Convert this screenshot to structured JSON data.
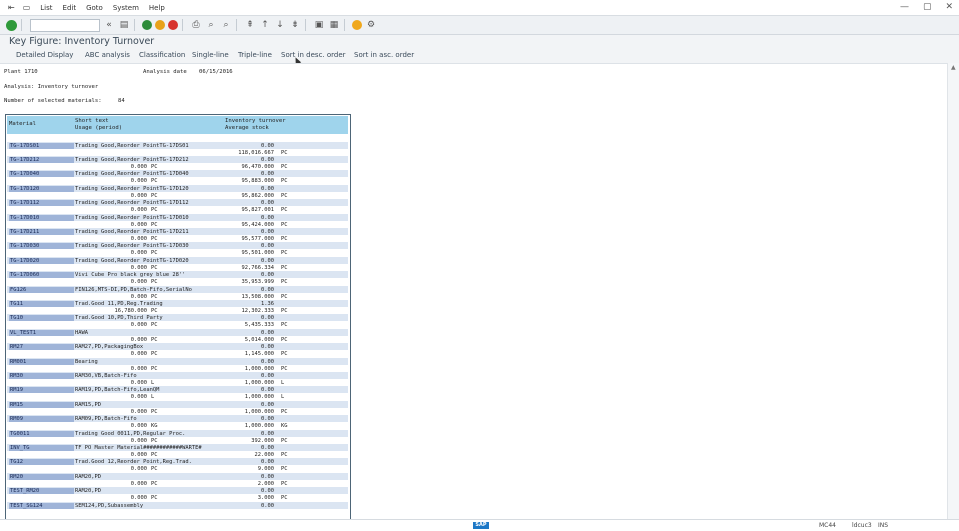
{
  "menu": {
    "items": [
      "List",
      "Edit",
      "Goto",
      "System",
      "Help"
    ]
  },
  "title": "Key Figure: Inventory Turnover",
  "app_toolbar": [
    "Detailed Display",
    "ABC analysis",
    "Classification",
    "Single-line",
    "Triple-line",
    "Sort in desc. order",
    "Sort in asc. order"
  ],
  "header": {
    "plant_label": "Plant 1710",
    "analysis_date_label": "Analysis date",
    "analysis_date": "06/15/2016",
    "analysis_label": "Analysis: Inventory turnover",
    "num_materials_label": "Number of selected materials:",
    "num_materials": "84"
  },
  "table": {
    "col1": "Material",
    "col2a": "Short text",
    "col2b": "Usage (period)",
    "col3a": "Inventory turnover",
    "col3b": "Average stock",
    "rows": [
      {
        "mat": "TG-17DS01",
        "text": "Trading Good,Reorder PointTG-17DS01",
        "v1": "0.00",
        "q": "",
        "u1": "",
        "v2": "118,016.667",
        "u2": "PC"
      },
      {
        "mat": "TG-17D212",
        "text": "Trading Good,Reorder PointTG-17D212",
        "v1": "0.00",
        "q": "0.000",
        "u1": "PC",
        "v2": "96,470.000",
        "u2": "PC"
      },
      {
        "mat": "TG-17D040",
        "text": "Trading Good,Reorder PointTG-17D040",
        "v1": "0.00",
        "q": "0.000",
        "u1": "PC",
        "v2": "95,883.000",
        "u2": "PC"
      },
      {
        "mat": "TG-17D120",
        "text": "Trading Good,Reorder PointTG-17D120",
        "v1": "0.00",
        "q": "0.000",
        "u1": "PC",
        "v2": "95,862.000",
        "u2": "PC"
      },
      {
        "mat": "TG-17D112",
        "text": "Trading Good,Reorder PointTG-17D112",
        "v1": "0.00",
        "q": "0.000",
        "u1": "PC",
        "v2": "95,827.001",
        "u2": "PC"
      },
      {
        "mat": "TG-17D010",
        "text": "Trading Good,Reorder PointTG-17D010",
        "v1": "0.00",
        "q": "0.000",
        "u1": "PC",
        "v2": "95,424.000",
        "u2": "PC"
      },
      {
        "mat": "TG-17D211",
        "text": "Trading Good,Reorder PointTG-17D211",
        "v1": "0.00",
        "q": "0.000",
        "u1": "PC",
        "v2": "95,577.000",
        "u2": "PC"
      },
      {
        "mat": "TG-17D030",
        "text": "Trading Good,Reorder PointTG-17D030",
        "v1": "0.00",
        "q": "0.000",
        "u1": "PC",
        "v2": "95,501.000",
        "u2": "PC"
      },
      {
        "mat": "TG-17D020",
        "text": "Trading Good,Reorder PointTG-17D020",
        "v1": "0.00",
        "q": "0.000",
        "u1": "PC",
        "v2": "92,766.334",
        "u2": "PC"
      },
      {
        "mat": "TG-17D060",
        "text": "Vivi Cube Pro black grey blue 28''",
        "v1": "0.00",
        "q": "0.000",
        "u1": "PC",
        "v2": "35,953.999",
        "u2": "PC"
      },
      {
        "mat": "FG126",
        "text": "FIN126,MTS-DI,PD,Batch-Fifo,SerialNo",
        "v1": "0.00",
        "q": "0.000",
        "u1": "PC",
        "v2": "13,508.000",
        "u2": "PC"
      },
      {
        "mat": "TG11",
        "text": "Trad.Good 11,PD,Reg.Trading",
        "v1": "1.36",
        "q": "16,780.000",
        "u1": "PC",
        "v2": "12,302.333",
        "u2": "PC"
      },
      {
        "mat": "TG10",
        "text": "Trad.Good 10,PD,Third Party",
        "v1": "0.00",
        "q": "0.000",
        "u1": "PC",
        "v2": "5,435.333",
        "u2": "PC"
      },
      {
        "mat": "VL_TEST1",
        "text": "HAWA",
        "v1": "0.00",
        "q": "0.000",
        "u1": "PC",
        "v2": "5,014.000",
        "u2": "PC"
      },
      {
        "mat": "RM27",
        "text": "RAM27,PD,PackagingBox",
        "v1": "0.00",
        "q": "0.000",
        "u1": "PC",
        "v2": "1,145.000",
        "u2": "PC"
      },
      {
        "mat": "RM001",
        "text": "Bearing",
        "v1": "0.00",
        "q": "0.000",
        "u1": "PC",
        "v2": "1,000.000",
        "u2": "PC"
      },
      {
        "mat": "RM30",
        "text": "RAM30,VB,Batch-Fifo",
        "v1": "0.00",
        "q": "0.000",
        "u1": "L",
        "v2": "1,000.000",
        "u2": "L"
      },
      {
        "mat": "RM19",
        "text": "RAM19,PD,Batch-Fifo,LeanQM",
        "v1": "0.00",
        "q": "0.000",
        "u1": "L",
        "v2": "1,000.000",
        "u2": "L"
      },
      {
        "mat": "RM15",
        "text": "RAM15,PD",
        "v1": "0.00",
        "q": "0.000",
        "u1": "PC",
        "v2": "1,000.000",
        "u2": "PC"
      },
      {
        "mat": "RM09",
        "text": "RAM09,PD,Batch-Fifo",
        "v1": "0.00",
        "q": "0.000",
        "u1": "KG",
        "v2": "1,000.000",
        "u2": "KG"
      },
      {
        "mat": "TG0011",
        "text": "Trading Good 0011,PD,Regular Proc.",
        "v1": "0.00",
        "q": "0.000",
        "u1": "PC",
        "v2": "392.000",
        "u2": "PC"
      },
      {
        "mat": "INV_TG",
        "text": "TF PO Master Material############WARTE#",
        "v1": "0.00",
        "q": "0.000",
        "u1": "PC",
        "v2": "22.000",
        "u2": "PC"
      },
      {
        "mat": "TG12",
        "text": "Trad.Good 12,Reorder Point,Reg.Trad.",
        "v1": "0.00",
        "q": "0.000",
        "u1": "PC",
        "v2": "9.000",
        "u2": "PC"
      },
      {
        "mat": "RM20",
        "text": "RAM20,PD",
        "v1": "0.00",
        "q": "0.000",
        "u1": "PC",
        "v2": "2.000",
        "u2": "PC"
      },
      {
        "mat": "TEST_RM20",
        "text": "RAM20,PD",
        "v1": "0.00",
        "q": "0.000",
        "u1": "PC",
        "v2": "3.000",
        "u2": "PC"
      },
      {
        "mat": "TEST_SG124",
        "text": "SEM124,PD,Subassembly",
        "v1": "0.00",
        "q": "",
        "u1": "",
        "v2": "",
        "u2": ""
      }
    ]
  },
  "status": {
    "sap": "SAP",
    "tx": "MC44",
    "server": "ldcuc3",
    "mode": "INS"
  },
  "colors": {
    "header_bg": "#9fd4ec",
    "row_bg": "#dbe5f2",
    "material_bg": "#9fb4d8"
  }
}
